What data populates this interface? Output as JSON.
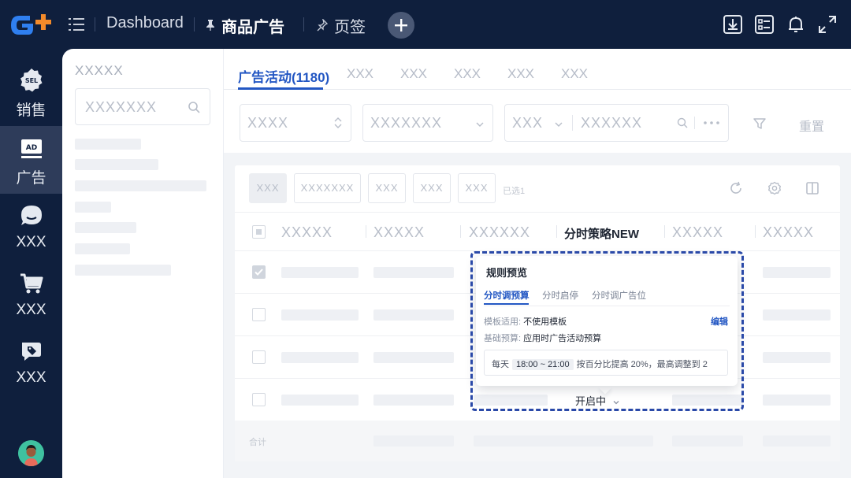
{
  "topbar": {
    "dashboard_label": "Dashboard",
    "tab_active_label": "商品广告",
    "tab_label": "页签"
  },
  "nav": {
    "items": [
      {
        "label": "销售",
        "icon": "sell-badge-icon",
        "badge": "SEL"
      },
      {
        "label": "广告",
        "icon": "ad-icon",
        "badge": "AD"
      },
      {
        "label": "XXX",
        "icon": "chat-bubble-icon"
      },
      {
        "label": "XXX",
        "icon": "shopping-cart-icon"
      },
      {
        "label": "XXX",
        "icon": "message-tag-icon"
      }
    ]
  },
  "subpanel": {
    "title": "XXXXX",
    "search_placeholder": "XXXXXXX"
  },
  "tabs": [
    "广告活动(1180)",
    "XXX",
    "XXX",
    "XXX",
    "XXX",
    "XXX"
  ],
  "filters": {
    "f1": "XXXX",
    "f2": "XXXXXXX",
    "f3": "XXX",
    "f4": "XXXXXX",
    "reset": "重置"
  },
  "toolbar": {
    "b1": "XXX",
    "b2": "XXXXXXX",
    "b3": "XXX",
    "b4": "XXX",
    "b5": "XXX",
    "selected": "已选1"
  },
  "table": {
    "headers": [
      "XXXXX",
      "XXXXX",
      "XXXXXX",
      "分时策略NEW",
      "XXXXX",
      "XXXXX"
    ],
    "status_value": "开启中",
    "total_label": "合计"
  },
  "popover": {
    "title": "规则预览",
    "tabs": [
      "分时调预算",
      "分时启停",
      "分时调广告位"
    ],
    "template_key": "模板适用:",
    "template_val": "不使用模板",
    "edit": "编辑",
    "budget_key": "基础预算:",
    "budget_val": "应用时广告活动预算",
    "rule_prefix": "每天",
    "rule_time": "18:00 ~ 21:00",
    "rule_suffix": "按百分比提高 20%，最高调整到 2"
  },
  "colors": {
    "nav_bg": "#0f1f3d",
    "accent": "#2357c3",
    "highlight": "#2a49a8"
  }
}
